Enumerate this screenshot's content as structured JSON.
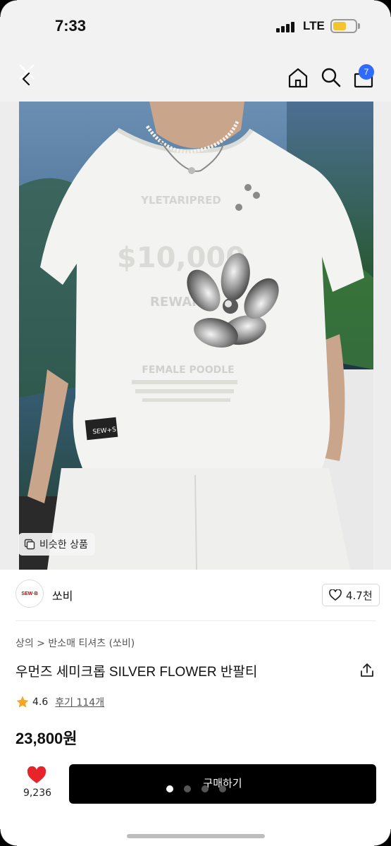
{
  "status_bar": {
    "time": "7:33",
    "network": "LTE",
    "battery_level": 0.6,
    "battery_color": "#f4c430"
  },
  "nav": {
    "back_icon": "back-arrow-icon",
    "home_icon": "home-icon",
    "search_icon": "search-icon",
    "cart_icon": "shopping-bag-icon",
    "cart_badge": "7",
    "badge_color": "#2f6bff"
  },
  "photo": {
    "similar_products_label": "비슷한 상품",
    "shirt_print": {
      "line1": "$10,000",
      "line2": "REWARD",
      "line3": "FEMALE POODLE",
      "tag": "SEW+S"
    }
  },
  "seller": {
    "logo_text": "SEW·B",
    "name": "쏘비",
    "likes": "4.7천"
  },
  "product": {
    "breadcrumb": "상의 > 반소매 티셔츠 (쏘비)",
    "title": "우먼즈 세미크롭 SILVER FLOWER 반팔티",
    "rating": "4.6",
    "reviews": "후기 114개",
    "price": "23,800원"
  },
  "bottom_bar": {
    "wish_count": "9,236",
    "buy_label": "구매하기",
    "heart_color": "#e8242b",
    "carousel_pages": 4,
    "carousel_active": 1
  }
}
